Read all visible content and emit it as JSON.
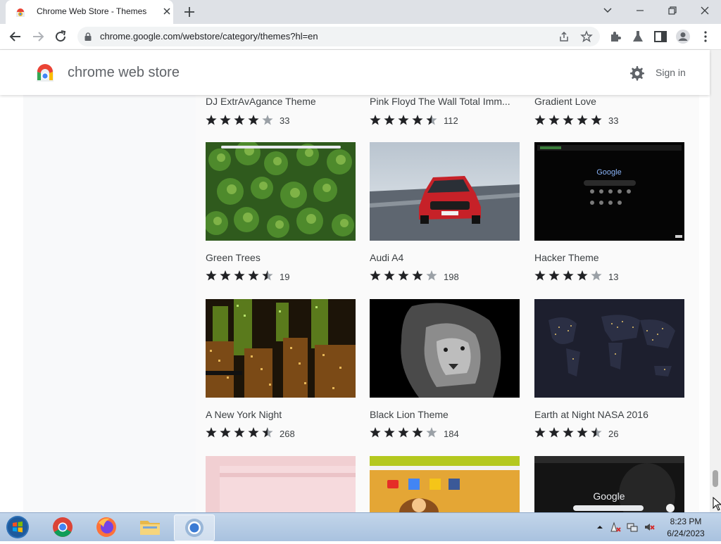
{
  "browser": {
    "tab_title": "Chrome Web Store - Themes",
    "url": "chrome.google.com/webstore/category/themes?hl=en"
  },
  "store": {
    "name": "chrome web store",
    "sign_in": "Sign in"
  },
  "top_row": [
    {
      "name": "DJ ExtrAvAgance Theme",
      "rating": 4.0,
      "count": "33"
    },
    {
      "name": "Pink Floyd The Wall Total Imm...",
      "rating": 4.5,
      "count": "112"
    },
    {
      "name": "Gradient Love",
      "rating": 5.0,
      "count": "33"
    }
  ],
  "themes": [
    {
      "name": "Green Trees",
      "rating": 4.5,
      "count": "19",
      "thumb": "green-trees"
    },
    {
      "name": "Audi A4",
      "rating": 4.0,
      "count": "198",
      "thumb": "audi-a4"
    },
    {
      "name": "Hacker Theme",
      "rating": 4.0,
      "count": "13",
      "thumb": "hacker-theme"
    },
    {
      "name": "A New York Night",
      "rating": 4.5,
      "count": "268",
      "thumb": "new-york-night"
    },
    {
      "name": "Black Lion Theme",
      "rating": 4.0,
      "count": "184",
      "thumb": "black-lion"
    },
    {
      "name": "Earth at Night NASA 2016",
      "rating": 4.5,
      "count": "26",
      "thumb": "earth-at-night"
    }
  ],
  "bottom_row_thumbs": [
    "pink-theme",
    "colorful-theme",
    "dark-google-theme"
  ],
  "thumb_text": {
    "google": "Google"
  },
  "taskbar": {
    "time": "8:23 PM",
    "date": "6/24/2023"
  },
  "colors": {
    "star": "#202124",
    "star_empty": "#9aa0a6",
    "accent": "#1a73e8"
  }
}
